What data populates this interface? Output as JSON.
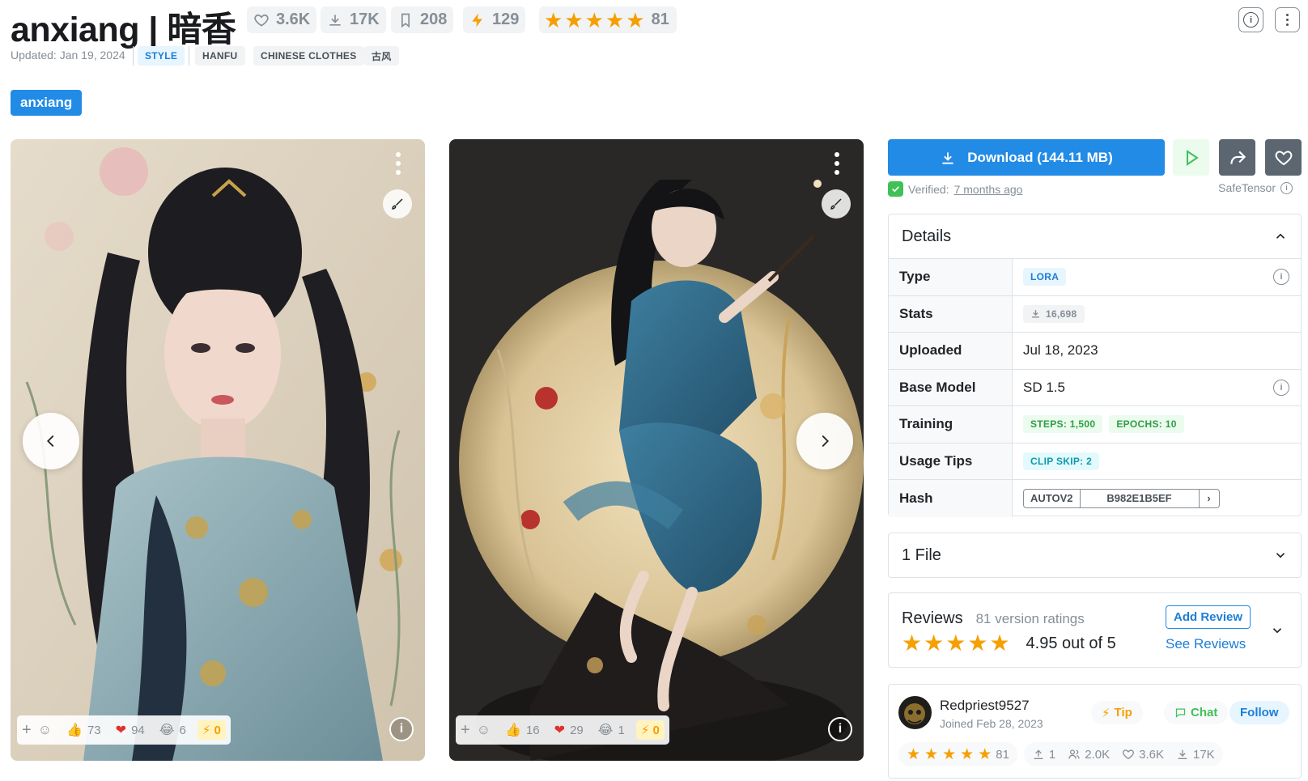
{
  "header": {
    "title": "anxiang | 暗香",
    "stats": {
      "likes": "3.6K",
      "downloads": "17K",
      "bookmarks": "208",
      "buzz": "129",
      "rating_count": "81"
    },
    "updated": "Updated: Jan 19, 2024",
    "tags": [
      "STYLE",
      "HANFU",
      "CHINESE CLOTHES",
      "古风"
    ],
    "trigger_word": "anxiang"
  },
  "gallery": [
    {
      "thumbs": "73",
      "hearts": "94",
      "laughs": "6",
      "buzz": "0"
    },
    {
      "thumbs": "16",
      "hearts": "29",
      "laughs": "1",
      "buzz": "0"
    }
  ],
  "download": {
    "label": "Download (144.11 MB)",
    "verified_label": "Verified:",
    "verified_time": "7 months ago",
    "format": "SafeTensor"
  },
  "details": {
    "title": "Details",
    "rows": {
      "type_label": "Type",
      "type_value": "LORA",
      "stats_label": "Stats",
      "stats_value": "16,698",
      "uploaded_label": "Uploaded",
      "uploaded_value": "Jul 18, 2023",
      "base_label": "Base Model",
      "base_value": "SD 1.5",
      "training_label": "Training",
      "steps": "STEPS: 1,500",
      "epochs": "EPOCHS: 10",
      "tips_label": "Usage Tips",
      "clip_skip": "CLIP SKIP: 2",
      "hash_label": "Hash",
      "hash_algo": "AUTOV2",
      "hash_value": "B982E1B5EF"
    }
  },
  "files": {
    "title": "1 File"
  },
  "reviews": {
    "title": "Reviews",
    "subtitle": "81 version ratings",
    "score": "4.95 out of 5",
    "add_label": "Add Review",
    "see_label": "See Reviews"
  },
  "creator": {
    "name": "Redpriest9527",
    "joined": "Joined Feb 28, 2023",
    "tip_label": "Tip",
    "chat_label": "Chat",
    "follow_label": "Follow",
    "rating_count": "81",
    "uploads": "1",
    "followers": "2.0K",
    "likes": "3.6K",
    "downloads": "17K"
  },
  "colors": {
    "accent": "#228be6",
    "star": "#f59f00",
    "verified": "#40c057"
  }
}
